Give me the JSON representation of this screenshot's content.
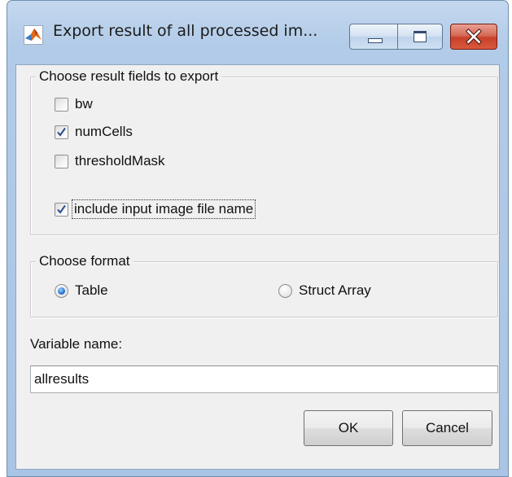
{
  "window": {
    "title": "Export result of all processed im...",
    "icon": "matlab-logo-icon"
  },
  "fields_group": {
    "title": "Choose result fields to export",
    "items": [
      {
        "label": "bw",
        "checked": false
      },
      {
        "label": "numCells",
        "checked": true
      },
      {
        "label": "thresholdMask",
        "checked": false
      },
      {
        "label": "include input image file name",
        "checked": true
      }
    ]
  },
  "format_group": {
    "title": "Choose format",
    "options": [
      {
        "label": "Table",
        "selected": true
      },
      {
        "label": "Struct Array",
        "selected": false
      }
    ]
  },
  "variable": {
    "label": "Variable name:",
    "value": "allresults"
  },
  "buttons": {
    "ok": "OK",
    "cancel": "Cancel"
  }
}
